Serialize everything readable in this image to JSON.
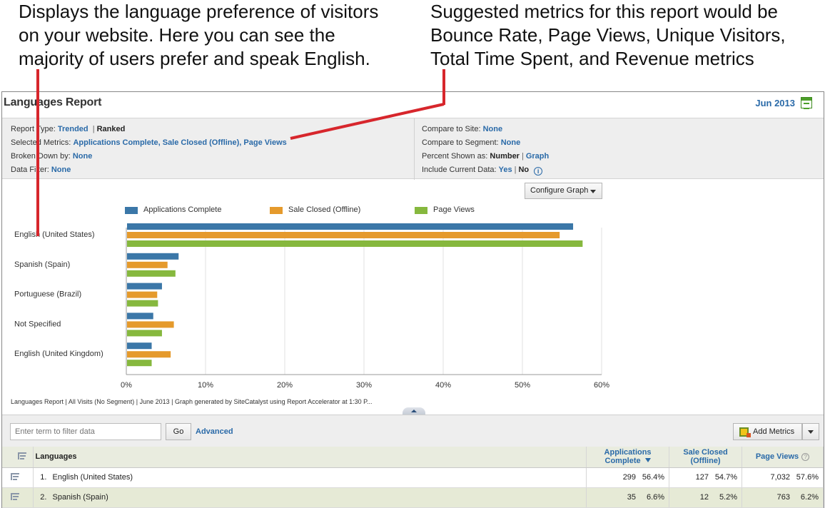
{
  "callouts": {
    "left": [
      "Displays the language preference of visitors",
      "on your website. Here you can see the",
      "majority of users prefer and speak English."
    ],
    "right": [
      "Suggested metrics for this report would be",
      "Bounce Rate, Page Views, Unique Visitors,",
      "Total Time Spent, and Revenue metrics"
    ]
  },
  "report": {
    "title": "Languages Report",
    "date": "Jun 2013",
    "calendar_icon": "calendar-icon"
  },
  "params": {
    "report_type": {
      "label": "Report Type:",
      "trended": "Trended",
      "sep": "|",
      "ranked": "Ranked"
    },
    "selected_metrics": {
      "label": "Selected Metrics:",
      "value": "Applications Complete, Sale Closed (Offline), Page Views"
    },
    "broken_down": {
      "label": "Broken Down by:",
      "value": "None"
    },
    "data_filter": {
      "label": "Data Filter:",
      "value": "None"
    },
    "compare_site": {
      "label": "Compare to Site:",
      "value": "None"
    },
    "compare_segment": {
      "label": "Compare to Segment:",
      "value": "None"
    },
    "percent_shown": {
      "label": "Percent Shown as:",
      "number": "Number",
      "sep": "|",
      "graph": "Graph"
    },
    "include_current": {
      "label": "Include Current Data:",
      "yes": "Yes",
      "sep": "|",
      "no": "No",
      "info_icon": "i"
    }
  },
  "configure_graph": {
    "label": "Configure Graph"
  },
  "chart_data": {
    "type": "bar",
    "orientation": "horizontal",
    "categories": [
      "English (United States)",
      "Spanish (Spain)",
      "Portuguese (Brazil)",
      "Not Specified",
      "English (United Kingdom)"
    ],
    "series": [
      {
        "name": "Applications Complete",
        "color": "#3b77a8",
        "values": [
          56.4,
          6.6,
          4.5,
          3.4,
          3.2
        ]
      },
      {
        "name": "Sale Closed (Offline)",
        "color": "#e59a2c",
        "values": [
          54.7,
          5.2,
          3.9,
          6.0,
          5.6
        ]
      },
      {
        "name": "Page Views",
        "color": "#86b83e",
        "values": [
          57.6,
          6.2,
          4.0,
          4.5,
          3.2
        ]
      }
    ],
    "xlim": [
      0,
      60
    ],
    "xticks": [
      "0%",
      "10%",
      "20%",
      "30%",
      "40%",
      "50%",
      "60%"
    ],
    "grid": true,
    "legend_position": "top"
  },
  "footnote": "Languages Report | All Visits (No Segment) | June 2013 | Graph generated by SiteCatalyst using Report Accelerator at  1:30 P...",
  "filter": {
    "placeholder": "Enter term to filter data",
    "go": "Go",
    "advanced": "Advanced",
    "add_metrics": "Add Metrics"
  },
  "table": {
    "headers": {
      "languages": "Languages",
      "apps_line1": "Applications",
      "apps_line2": "Complete",
      "sale_line1": "Sale Closed",
      "sale_line2": "(Offline)",
      "page_views": "Page Views",
      "help": "?"
    },
    "rows": [
      {
        "rank": "1.",
        "language": "English (United States)",
        "apps": "299",
        "apps_pct": "56.4%",
        "sale": "127",
        "sale_pct": "54.7%",
        "pv": "7,032",
        "pv_pct": "57.6%"
      },
      {
        "rank": "2.",
        "language": "Spanish (Spain)",
        "apps": "35",
        "apps_pct": "6.6%",
        "sale": "12",
        "sale_pct": "5.2%",
        "pv": "763",
        "pv_pct": "6.2%"
      }
    ]
  },
  "colors": {
    "link": "#2a6aa8",
    "annotation_red": "#d7262c"
  }
}
